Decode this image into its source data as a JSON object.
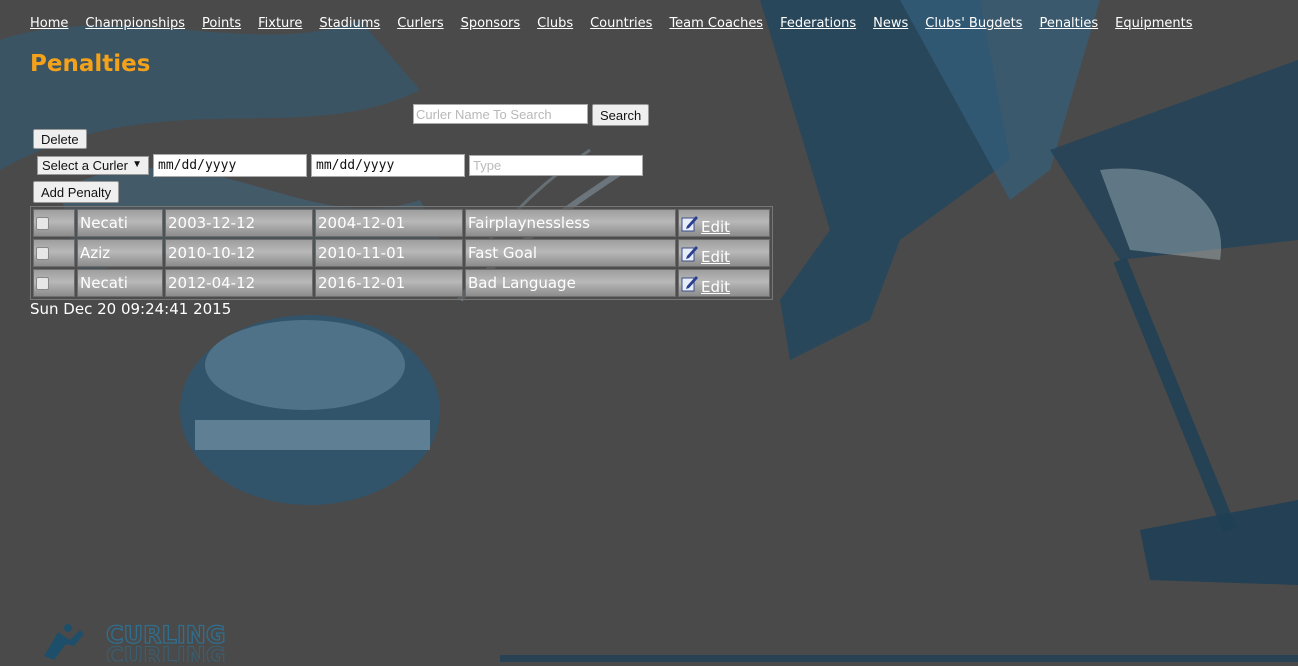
{
  "nav": {
    "items": [
      "Home",
      "Championships",
      "Points",
      "Fixture",
      "Stadiums",
      "Curlers",
      "Sponsors",
      "Clubs",
      "Countries",
      "Team Coaches",
      "Federations",
      "News",
      "Clubs' Bugdets",
      "Penalties",
      "Equipments"
    ]
  },
  "page": {
    "title": "Penalties"
  },
  "search": {
    "placeholder": "Curler Name To Search",
    "button": "Search"
  },
  "actions": {
    "delete": "Delete",
    "add_penalty": "Add Penalty"
  },
  "form": {
    "curler_select": "Select a Curler",
    "start_date_placeholder": "mm/dd/yyyy",
    "end_date_placeholder": "mm/dd/yyyy",
    "type_placeholder": "Type"
  },
  "table": {
    "rows": [
      {
        "name": "Necati",
        "start": "2003-12-12",
        "end": "2004-12-01",
        "type": "Fairplaynessless",
        "edit": "Edit"
      },
      {
        "name": "Aziz",
        "start": "2010-10-12",
        "end": "2010-11-01",
        "type": "Fast Goal",
        "edit": "Edit"
      },
      {
        "name": "Necati",
        "start": "2012-04-12",
        "end": "2016-12-01",
        "type": "Bad Language",
        "edit": "Edit"
      }
    ]
  },
  "footer": {
    "timestamp": "Sun Dec 20 09:24:41 2015",
    "logo_text": "CURLING"
  },
  "colors": {
    "accent": "#f5a21b",
    "background": "#4a4a4a"
  },
  "icons": {
    "edit": "edit-pencil-icon"
  }
}
